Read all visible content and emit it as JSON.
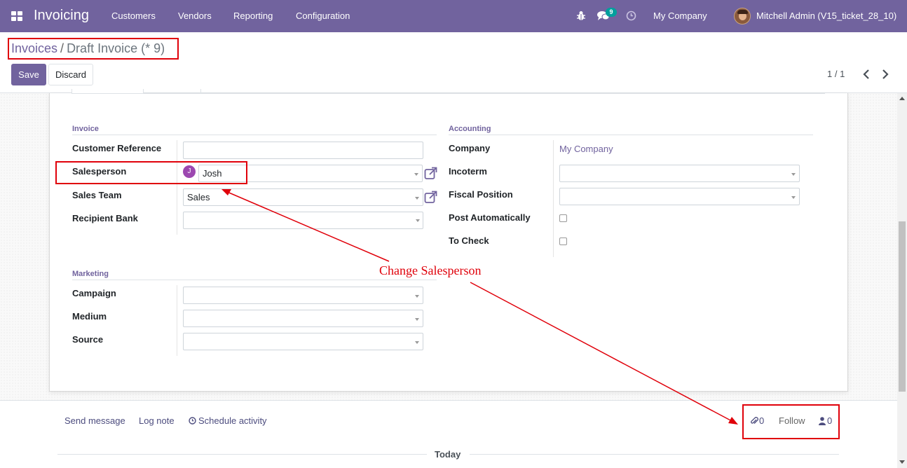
{
  "navbar": {
    "app_title": "Invoicing",
    "menu": [
      "Customers",
      "Vendors",
      "Reporting",
      "Configuration"
    ],
    "messages_badge": "9",
    "company": "My Company",
    "user": "Mitchell Admin (V15_ticket_28_10)",
    "icons": [
      "apps-grid-icon",
      "bug-icon",
      "comments-icon",
      "clock-icon"
    ]
  },
  "breadcrumb": {
    "parent": "Invoices",
    "separator": "/",
    "current": "Draft Invoice (* 9)"
  },
  "buttons": {
    "save": "Save",
    "discard": "Discard"
  },
  "pager": {
    "value": "1 / 1"
  },
  "invoice_group": {
    "title": "Invoice",
    "customer_reference_label": "Customer Reference",
    "customer_reference_value": "",
    "salesperson_label": "Salesperson",
    "salesperson_initial": "J",
    "salesperson_value": "Josh",
    "sales_team_label": "Sales Team",
    "sales_team_value": "Sales",
    "recipient_bank_label": "Recipient Bank",
    "recipient_bank_value": ""
  },
  "accounting_group": {
    "title": "Accounting",
    "company_label": "Company",
    "company_value": "My Company",
    "incoterm_label": "Incoterm",
    "fiscal_position_label": "Fiscal Position",
    "post_automatically_label": "Post Automatically",
    "post_automatically_checked": false,
    "to_check_label": "To Check",
    "to_check_checked": false
  },
  "marketing_group": {
    "title": "Marketing",
    "campaign_label": "Campaign",
    "medium_label": "Medium",
    "source_label": "Source"
  },
  "annotation": {
    "text": "Change Salesperson",
    "color": "#e0000a"
  },
  "chatter": {
    "send_message": "Send message",
    "log_note": "Log note",
    "schedule_activity": "Schedule activity",
    "attachments_count": "0",
    "follow": "Follow",
    "followers_count": "0",
    "today": "Today"
  },
  "colors": {
    "brand": "#71639e",
    "badge": "#00a09d"
  }
}
